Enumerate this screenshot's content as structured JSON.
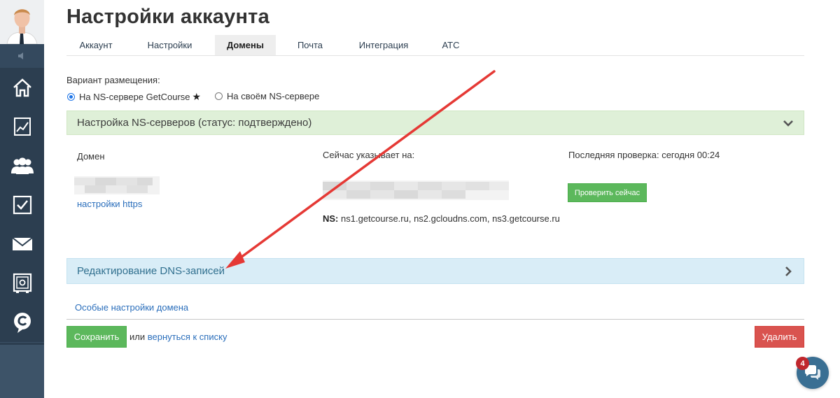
{
  "header": {
    "title": "Настройки аккаунта"
  },
  "tabs": [
    {
      "label": "Аккаунт"
    },
    {
      "label": "Настройки"
    },
    {
      "label": "Домены",
      "active": true
    },
    {
      "label": "Почта"
    },
    {
      "label": "Интеграция"
    },
    {
      "label": "АТС"
    }
  ],
  "placement": {
    "label": "Вариант размещения:",
    "options": [
      {
        "label": "На NS-сервере GetCourse",
        "checked": true,
        "star": "★"
      },
      {
        "label": "На своём NS-сервере",
        "checked": false
      }
    ]
  },
  "ns_panel": {
    "title": "Настройка NS-серверов (статус: подтверждено)",
    "domain_label": "Домен",
    "https_link": "настройки https",
    "points_to_label": "Сейчас указывает на:",
    "ns_prefix": "NS:",
    "ns_values": "ns1.getcourse.ru, ns2.gcloudns.com, ns3.getcourse.ru",
    "last_check": "Последняя проверка: сегодня 00:24",
    "check_button": "Проверить сейчас"
  },
  "dns_panel": {
    "title": "Редактирование DNS-записей"
  },
  "special_link": "Особые настройки домена",
  "footer": {
    "save_button": "Сохранить",
    "or_text": "или",
    "back_link": "вернуться к списку",
    "delete_button": "Удалить"
  },
  "chat": {
    "badge": "4"
  },
  "sidebar": {
    "items": [
      "home-icon",
      "chart-icon",
      "users-icon",
      "tasks-icon",
      "mail-icon",
      "safe-icon",
      "getcourse-logo-icon"
    ]
  },
  "colors": {
    "sidebar": "#2c3e50",
    "success": "#5cb85c",
    "danger": "#d9534f",
    "link": "#2a6ebb",
    "ns_panel_bg": "#dff0d8",
    "dns_panel_bg": "#d9edf7",
    "arrow": "#e53935"
  }
}
